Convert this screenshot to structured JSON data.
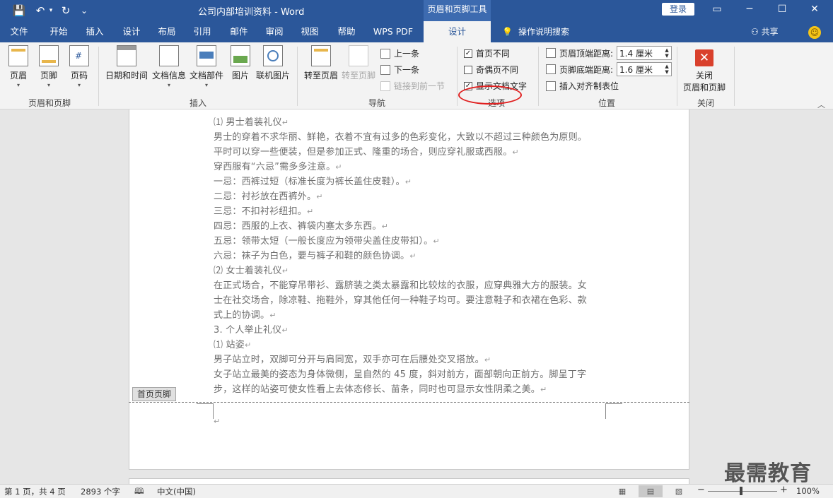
{
  "titlebar": {
    "title": "公司内部培训资料  -  Word",
    "contextual_tab": "页眉和页脚工具",
    "login": "登录",
    "qa_save": "💾",
    "qa_undo": "↶",
    "qa_redo": "↻",
    "qa_more": "⌄",
    "win_ribbon": "▭",
    "win_min": "─",
    "win_max": "☐",
    "win_close": "✕"
  },
  "tabs": [
    "文件",
    "开始",
    "插入",
    "设计",
    "布局",
    "引用",
    "邮件",
    "审阅",
    "视图",
    "帮助",
    "WPS PDF",
    "设计"
  ],
  "tell_me": "操作说明搜索",
  "share": "共享",
  "ribbon": {
    "groups": {
      "header_footer": "页眉和页脚",
      "insert": "插入",
      "navigation": "导航",
      "options": "选项",
      "position": "位置",
      "close": "关闭"
    },
    "header": "页眉",
    "footer": "页脚",
    "page_number": "页码",
    "date_time": "日期和时间",
    "doc_info": "文档信息",
    "doc_parts": "文档部件",
    "picture": "图片",
    "online_picture": "联机图片",
    "goto_header": "转至页眉",
    "goto_footer": "转至页脚",
    "prev": "上一条",
    "next": "下一条",
    "link_prev": "链接到前一节",
    "diff_first": "首页不同",
    "diff_odd_even": "奇偶页不同",
    "show_doc_text": "显示文档文字",
    "header_top_label": "页眉顶端距离:",
    "header_top_value": "1.4 厘米",
    "footer_bottom_label": "页脚底端距离:",
    "footer_bottom_value": "1.6 厘米",
    "insert_align_tab": "插入对齐制表位",
    "close_hf_1": "关闭",
    "close_hf_2": "页眉和页脚"
  },
  "document": {
    "lines": [
      "⑴ 男士着装礼仪",
      "男士的穿着不求华丽、鲜艳，衣着不宜有过多的色彩变化，大致以不超过三种颜色为原则。",
      "平时可以穿一些便装，但是参加正式、隆重的场合，则应穿礼服或西服。",
      "穿西服有“六忌”需多多注意。",
      "一忌：西裤过短（标准长度为裤长盖住皮鞋）。",
      "二忌：衬衫放在西裤外。",
      "三忌：不扣衬衫纽扣。",
      "四忌：西服的上衣、裤袋内塞太多东西。",
      "五忌：领带太短（一般长度应为领带尖盖住皮带扣）。",
      "六忌：袜子为白色，要与裤子和鞋的颜色协调。",
      "⑵ 女士着装礼仪",
      "在正式场合，不能穿吊带衫、露脐装之类太暴露和比较炫的衣服，应穿典雅大方的服装。女",
      "士在社交场合，除凉鞋、拖鞋外，穿其他任何一种鞋子均可。要注意鞋子和衣裙在色彩、款",
      "式上的协调。",
      "3. 个人举止礼仪",
      "⑴ 站姿",
      "男子站立时，双脚可分开与肩同宽，双手亦可在后腰处交叉搭放。",
      "女子站立最美的姿态为身体微侧，呈自然的 45 度，斜对前方，面部朝向正前方。脚呈丁字",
      "步，这样的站姿可使女性看上去体态修长、苗条，同时也可显示女性阴柔之美。"
    ],
    "pilcrow": "↵",
    "header_tag": "首页页脚"
  },
  "watermark": "最需教育",
  "statusbar": {
    "page": "第 1 页，共 4 页",
    "words": "2893 个字",
    "proof": "🕮",
    "lang": "中文(中国)",
    "view_read": "▦",
    "view_print": "▤",
    "view_web": "▧",
    "zoom_minus": "−",
    "zoom_plus": "+",
    "zoom": "100%"
  },
  "colors": {
    "accent": "#2b579a",
    "highlight_circle": "#e02020",
    "close_icon": "#d9402c"
  }
}
